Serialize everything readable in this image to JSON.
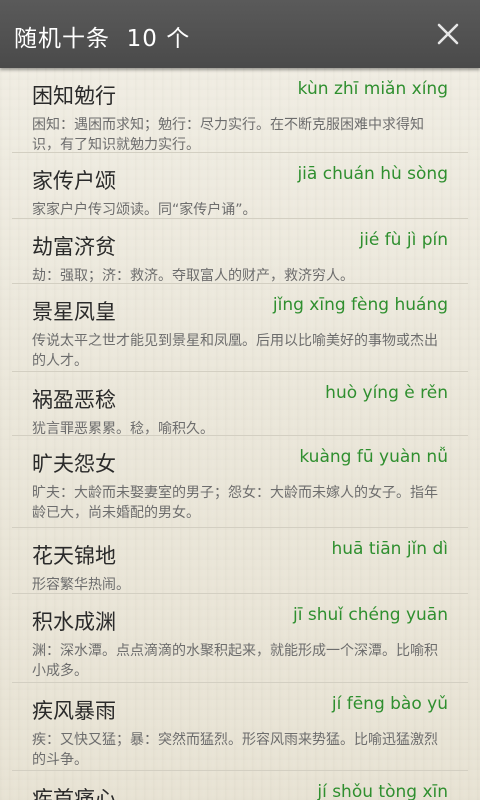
{
  "header": {
    "title": "随机十条  10 个",
    "close_icon": "close-icon"
  },
  "colors": {
    "header_bg": "#4f4f4f",
    "pinyin_green": "#2f8f2f",
    "text_dark": "#2a2a2a",
    "text_gray": "#6d6d6d"
  },
  "items": [
    {
      "idiom": "困知勉行",
      "pinyin": "kùn zhī miǎn xíng",
      "meaning": "困知：遇困而求知；勉行：尽力实行。在不断克服困难中求得知识，有了知识就勉力实行。"
    },
    {
      "idiom": "家传户颂",
      "pinyin": "jiā chuán hù sòng",
      "meaning": "家家户户传习颂读。同“家传户诵”。"
    },
    {
      "idiom": "劫富济贫",
      "pinyin": "jié fù jì pín",
      "meaning": "劫：强取；济：救济。夺取富人的财产，救济穷人。"
    },
    {
      "idiom": "景星凤皇",
      "pinyin": "jǐng xīng fèng huáng",
      "meaning": "传说太平之世才能见到景星和凤凰。后用以比喻美好的事物或杰出的人才。"
    },
    {
      "idiom": "祸盈恶稔",
      "pinyin": "huò yíng è rěn",
      "meaning": "犹言罪恶累累。稔，喻积久。"
    },
    {
      "idiom": "旷夫怨女",
      "pinyin": "kuàng fū yuàn nǚ",
      "meaning": "旷夫：大龄而未娶妻室的男子；怨女：大龄而未嫁人的女子。指年龄已大，尚未婚配的男女。"
    },
    {
      "idiom": "花天锦地",
      "pinyin": "huā tiān jǐn dì",
      "meaning": "形容繁华热闹。"
    },
    {
      "idiom": "积水成渊",
      "pinyin": "jī shuǐ chéng yuān",
      "meaning": "渊：深水潭。点点滴滴的水聚积起来，就能形成一个深潭。比喻积小成多。"
    },
    {
      "idiom": "疾风暴雨",
      "pinyin": "jí fēng bào yǔ",
      "meaning": "疾：又快又猛；暴：突然而猛烈。形容风雨来势猛。比喻迅猛激烈的斗争。"
    },
    {
      "idiom": "疾首痛心",
      "pinyin": "jí shǒu tòng xīn",
      "meaning": ""
    }
  ]
}
